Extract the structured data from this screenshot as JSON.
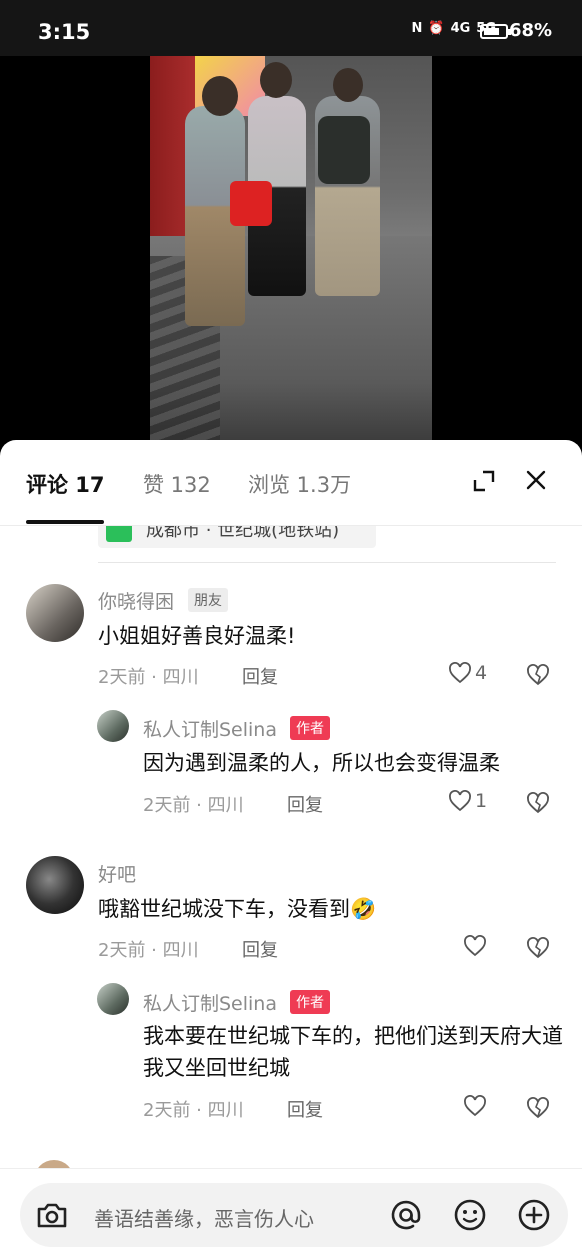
{
  "status": {
    "time": "3:15",
    "battery": "68%",
    "network": [
      "4G",
      "5G"
    ]
  },
  "tabs": [
    {
      "label": "评论 17",
      "active": true
    },
    {
      "label": "赞 132",
      "active": false
    },
    {
      "label": "浏览 1.3万",
      "active": false
    }
  ],
  "location": {
    "text": "成都市 · 世纪城(地铁站)"
  },
  "comments": [
    {
      "name": "你晓得困",
      "badge": "朋友",
      "text": "小姐姐好善良好温柔!",
      "meta": "2天前 · 四川",
      "reply": "回复",
      "likes": "4"
    },
    {
      "name": "私人订制Selina",
      "badge": "作者",
      "text": "因为遇到温柔的人，所以也会变得温柔",
      "meta": "2天前 · 四川",
      "reply": "回复",
      "likes": "1"
    },
    {
      "name": "好吧",
      "badge": "",
      "text": "哦豁世纪城没下车，没看到🤣",
      "meta": "2天前 · 四川",
      "reply": "回复",
      "likes": ""
    },
    {
      "name": "私人订制Selina",
      "badge": "作者",
      "text": "我本要在世纪城下车的，把他们送到天府大道我又坐回世纪城",
      "meta": "2天前 · 四川",
      "reply": "回复",
      "likes": ""
    }
  ],
  "input": {
    "placeholder": "善语结善缘，恶言伤人心"
  },
  "colors": {
    "author_badge": "#ef3b54",
    "location_pin": "#2bbf5a"
  }
}
